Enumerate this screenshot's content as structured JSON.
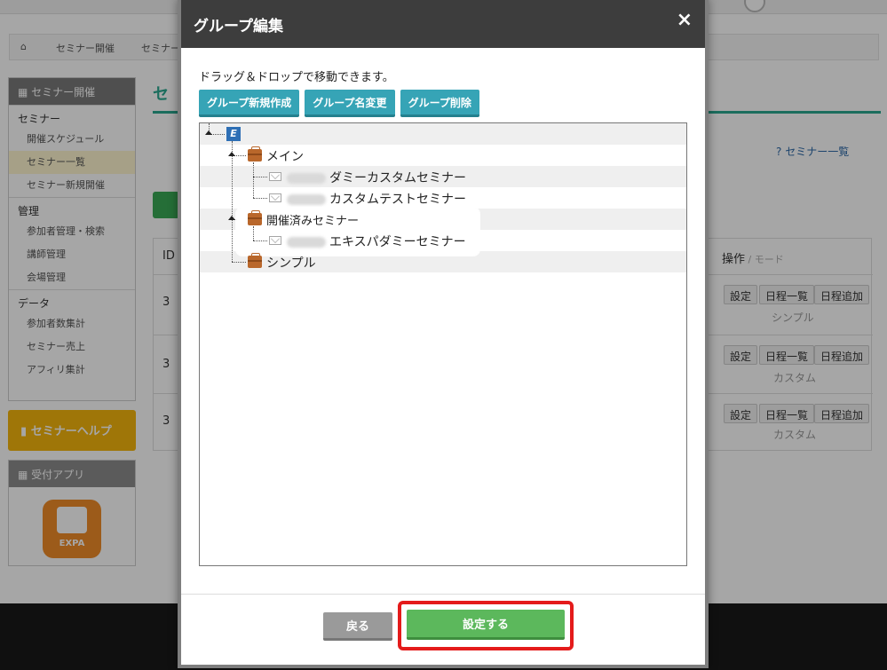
{
  "background": {
    "breadcrumbs": [
      "セミナー開催",
      "セミナー"
    ],
    "sidebar": {
      "header": "セミナー開催",
      "sections": [
        {
          "title": "セミナー",
          "items": [
            "開催スケジュール",
            "セミナー一覧",
            "セミナー新規開催"
          ]
        },
        {
          "title": "管理",
          "items": [
            "参加者管理・検索",
            "講師管理",
            "会場管理"
          ]
        },
        {
          "title": "データ",
          "items": [
            "参加者数集計",
            "セミナー売上",
            "アフィリ集計"
          ]
        }
      ]
    },
    "help_label": "セミナーヘルプ",
    "app_panel_title": "受付アプリ",
    "app_icon_text": "EXPA",
    "main_title": "セ",
    "right_link": "セミナー一覧",
    "table": {
      "id_header": "ID",
      "ops_header": "操作",
      "mode_header": "モード",
      "rows": [
        {
          "id": "3",
          "buttons": [
            "設定",
            "日程一覧",
            "日程追加"
          ],
          "mode": "シンプル"
        },
        {
          "id": "3",
          "buttons": [
            "設定",
            "日程一覧",
            "日程追加"
          ],
          "mode": "カスタム"
        },
        {
          "id": "3",
          "buttons": [
            "設定",
            "日程一覧",
            "日程追加"
          ],
          "mode": "カスタム"
        }
      ]
    }
  },
  "modal": {
    "title": "グループ編集",
    "close_glyph": "×",
    "hint": "ドラッグ＆ドロップで移動できます。",
    "toolbar": {
      "new_group": "グループ新規作成",
      "rename_group": "グループ名変更",
      "delete_group": "グループ削除"
    },
    "tree": {
      "root_logo": "E",
      "groups": [
        {
          "name": "メイン",
          "items": [
            "ダミーカスタムセミナー",
            "カスタムテストセミナー"
          ]
        },
        {
          "name": "開催済みセミナー",
          "items": [
            "エキスパダミーセミナー"
          ]
        },
        {
          "name": "シンプル",
          "items": []
        }
      ]
    },
    "footer": {
      "back_label": "戻る",
      "save_label": "設定する"
    }
  },
  "colors": {
    "modal_header": "#3d3d3d",
    "tool_button": "#36a4b6",
    "save_button": "#5cb85c",
    "back_button": "#9a9a9a",
    "highlight_frame": "#e41b1b"
  }
}
